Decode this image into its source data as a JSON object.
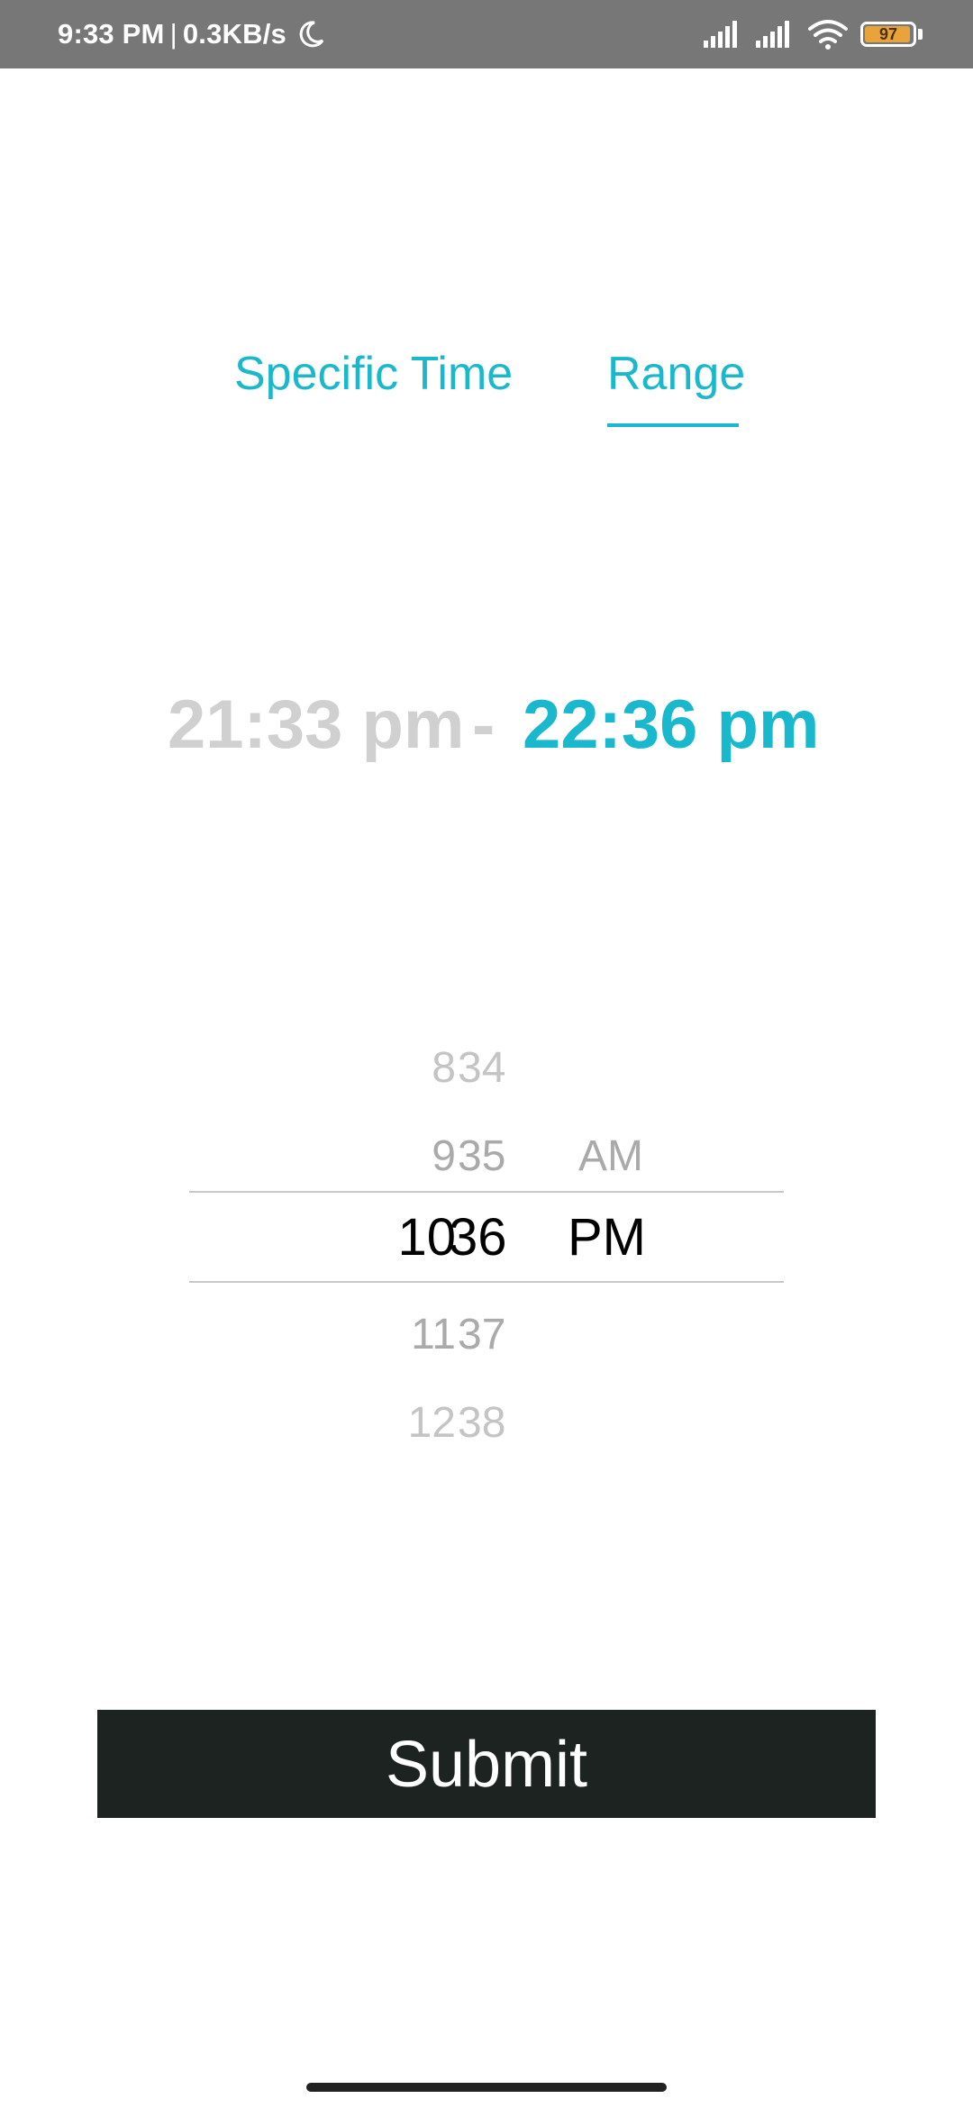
{
  "status_bar": {
    "time": "9:33 PM",
    "separator": "|",
    "network_speed": "0.3KB/s",
    "battery_level": "97",
    "battery_fraction": 0.97,
    "icons": [
      "moon-icon",
      "signal-icon",
      "signal-icon",
      "wifi-icon",
      "battery-icon"
    ],
    "colors": {
      "background": "#777777",
      "battery_fill": "#e8a33a"
    }
  },
  "tabs": {
    "items": [
      {
        "label": "Specific Time",
        "active": false
      },
      {
        "label": "Range",
        "active": true
      }
    ]
  },
  "range": {
    "start": "21:33 pm",
    "separator": "-",
    "end": "22:36 pm"
  },
  "picker": {
    "hours": [
      "8",
      "9",
      "10",
      "11",
      "12"
    ],
    "minutes": [
      "34",
      "35",
      "36",
      "37",
      "38"
    ],
    "periods": [
      "AM",
      "PM"
    ],
    "selected": {
      "hour": "10",
      "minute": "36",
      "period": "PM"
    }
  },
  "submit": {
    "label": "Submit"
  },
  "colors": {
    "accent": "#1ab8cc",
    "inactive_text": "#d0d0d0",
    "button_background": "#1c2321",
    "button_text": "#ffffff"
  }
}
